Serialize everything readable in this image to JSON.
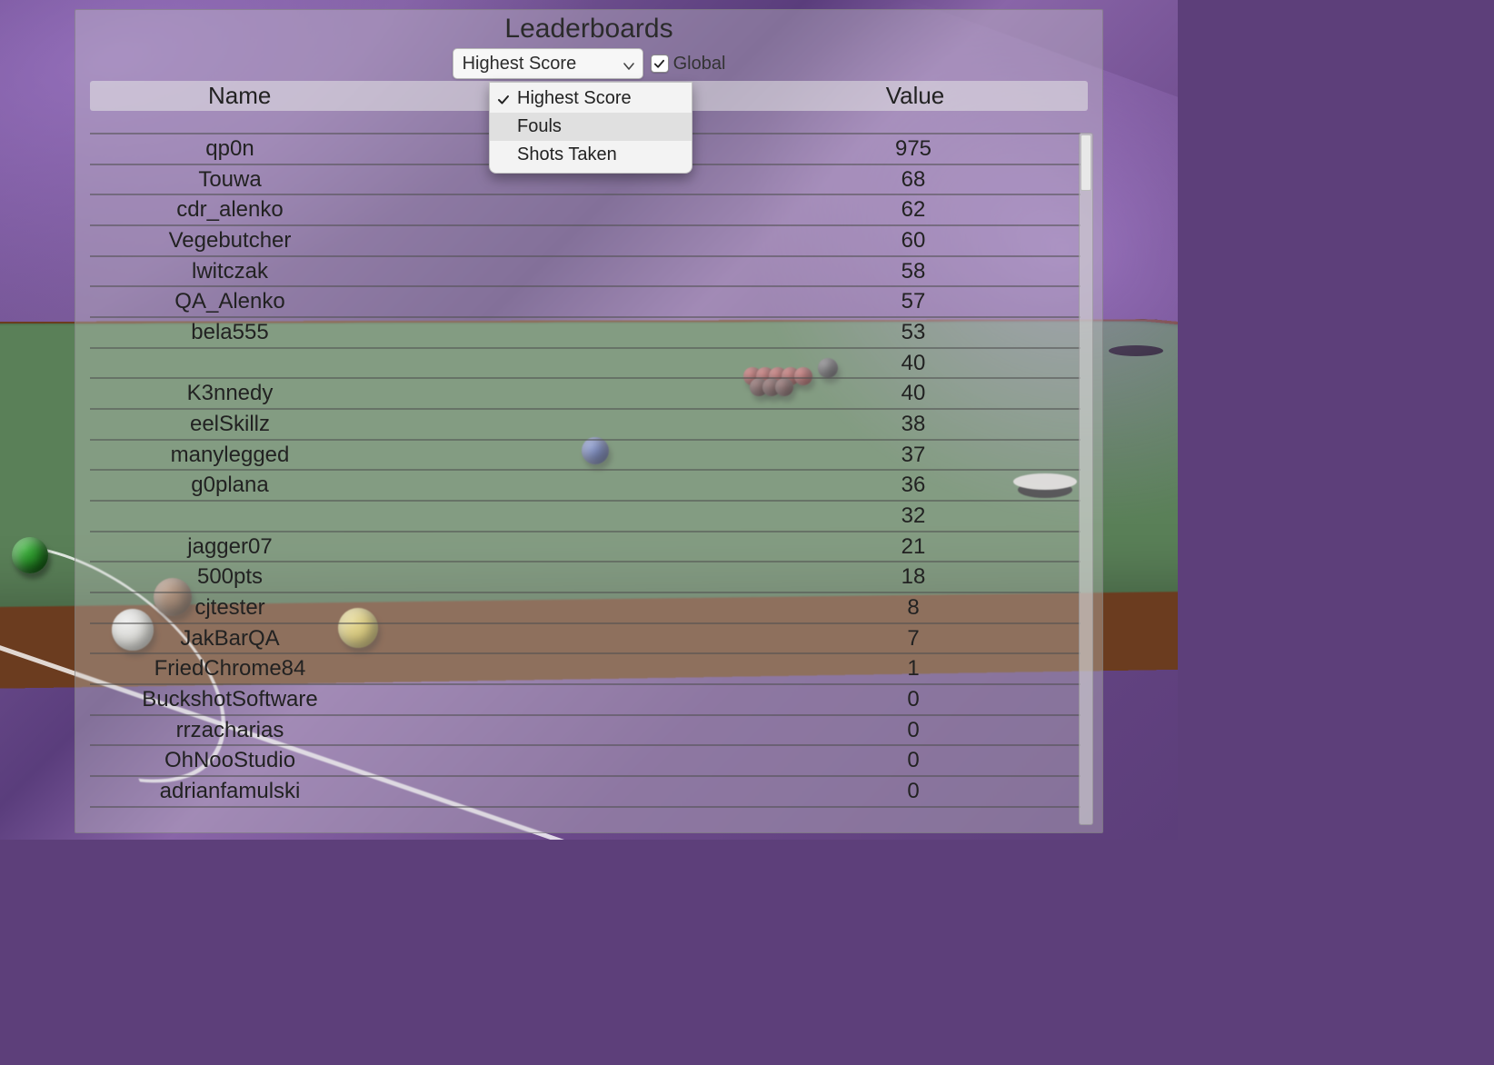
{
  "title": "Leaderboards",
  "select": {
    "label": "Highest Score",
    "options": [
      "Highest Score",
      "Fouls",
      "Shots Taken"
    ],
    "highlighted_index": 1,
    "checked_index": 0
  },
  "global": {
    "checked": true,
    "label": "Global"
  },
  "columns": {
    "name": "Name",
    "value": "Value"
  },
  "rows": [
    {
      "name": "qp0n",
      "value": "975"
    },
    {
      "name": "Touwa",
      "value": "68"
    },
    {
      "name": "cdr_alenko",
      "value": "62"
    },
    {
      "name": "Vegebutcher",
      "value": "60"
    },
    {
      "name": "lwitczak",
      "value": "58"
    },
    {
      "name": "QA_Alenko",
      "value": "57"
    },
    {
      "name": "bela555",
      "value": "53"
    },
    {
      "name": "",
      "value": "40"
    },
    {
      "name": "K3nnedy",
      "value": "40"
    },
    {
      "name": "eelSkillz",
      "value": "38"
    },
    {
      "name": "manylegged",
      "value": "37"
    },
    {
      "name": "g0plana",
      "value": "36"
    },
    {
      "name": "",
      "value": "32"
    },
    {
      "name": "jagger07",
      "value": "21"
    },
    {
      "name": "500pts",
      "value": "18"
    },
    {
      "name": "cjtester",
      "value": "8"
    },
    {
      "name": "JakBarQA",
      "value": "7"
    },
    {
      "name": "FriedChrome84",
      "value": "1"
    },
    {
      "name": "BuckshotSoftware",
      "value": "0"
    },
    {
      "name": "rrzacharias",
      "value": "0"
    },
    {
      "name": "OhNooStudio",
      "value": "0"
    },
    {
      "name": "adrianfamulski",
      "value": "0"
    }
  ]
}
